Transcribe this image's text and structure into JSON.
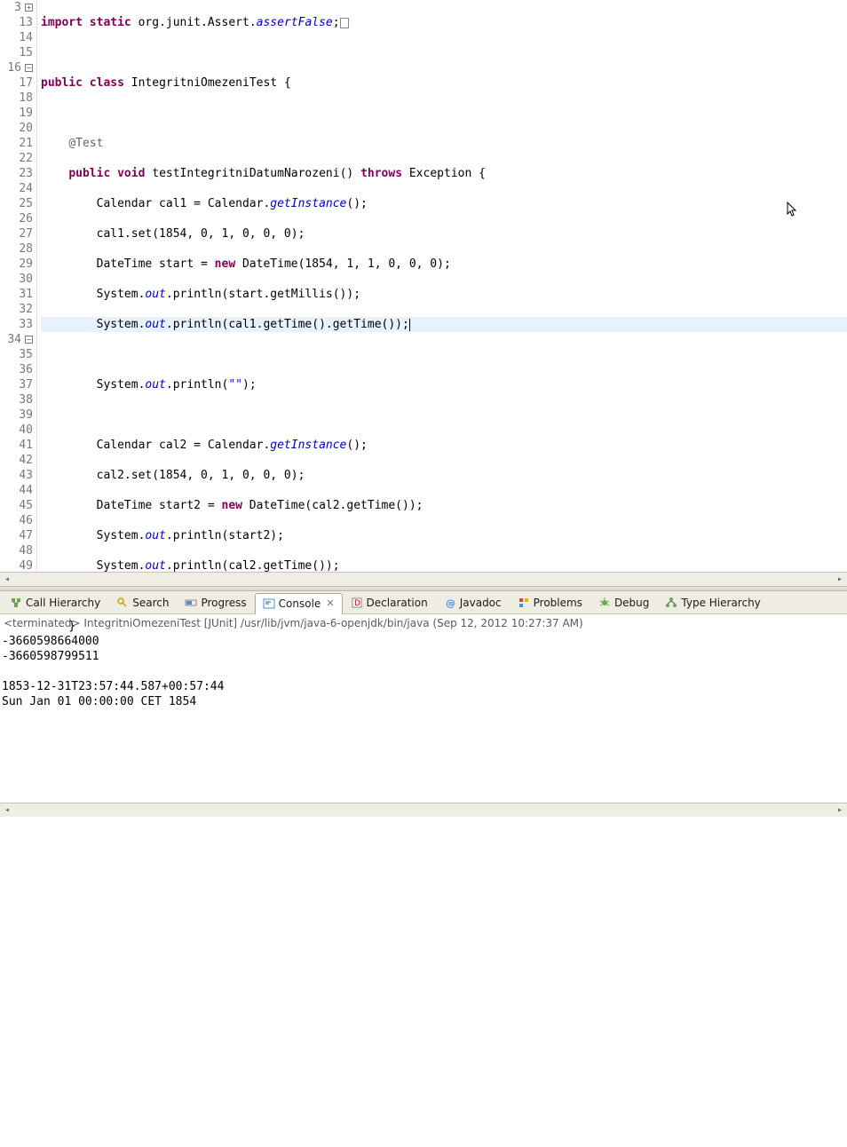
{
  "editor": {
    "lines": [
      {
        "n": 3,
        "marker": "plus"
      },
      {
        "n": 13
      },
      {
        "n": 14
      },
      {
        "n": 15
      },
      {
        "n": 16,
        "marker": "minus"
      },
      {
        "n": 17
      },
      {
        "n": 18
      },
      {
        "n": 19
      },
      {
        "n": 20
      },
      {
        "n": 21
      },
      {
        "n": 22,
        "hl": true
      },
      {
        "n": 23
      },
      {
        "n": 24
      },
      {
        "n": 25
      },
      {
        "n": 26
      },
      {
        "n": 27
      },
      {
        "n": 28
      },
      {
        "n": 29
      },
      {
        "n": 30
      },
      {
        "n": 31
      },
      {
        "n": 32
      },
      {
        "n": 33
      },
      {
        "n": 34,
        "marker": "minus"
      },
      {
        "n": 35
      },
      {
        "n": 36
      },
      {
        "n": 37
      },
      {
        "n": 38
      },
      {
        "n": 39
      },
      {
        "n": 40
      },
      {
        "n": 41
      },
      {
        "n": 42
      },
      {
        "n": 43
      },
      {
        "n": 44
      },
      {
        "n": 45
      },
      {
        "n": 46
      },
      {
        "n": 47
      },
      {
        "n": 48
      },
      {
        "n": 49
      }
    ],
    "code": {
      "l3_a": "import",
      "l3_b": "static",
      "l3_c": " org.junit.Assert.",
      "l3_d": "assertFalse",
      "l3_e": ";",
      "l14_a": "public",
      "l14_b": "class",
      "l14_c": " IntegritniOmezeniTest {",
      "l16": "@Test",
      "l17_a": "public",
      "l17_b": "void",
      "l17_c": " testIntegritniDatumNarozeni() ",
      "l17_d": "throws",
      "l17_e": " Exception {",
      "l18_a": "        Calendar cal1 = Calendar.",
      "l18_b": "getInstance",
      "l18_c": "();",
      "l19": "        cal1.set(1854, 0, 1, 0, 0, 0);",
      "l20_a": "        DateTime start = ",
      "l20_b": "new",
      "l20_c": " DateTime(1854, 1, 1, 0, 0, 0);",
      "l21_a": "        System.",
      "l21_b": "out",
      "l21_c": ".println(start.getMillis());",
      "l22_a": "        System.",
      "l22_b": "out",
      "l22_c": ".println(cal1.getTime().getTime());",
      "l24_a": "        System.",
      "l24_b": "out",
      "l24_c": ".println(",
      "l24_d": "\"\"",
      "l24_e": ");",
      "l26_a": "        Calendar cal2 = Calendar.",
      "l26_b": "getInstance",
      "l26_c": "();",
      "l27": "        cal2.set(1854, 0, 1, 0, 0, 0);",
      "l28_a": "        DateTime start2 = ",
      "l28_b": "new",
      "l28_c": " DateTime(cal2.getTime());",
      "l29_a": "        System.",
      "l29_b": "out",
      "l29_c": ".println(start2);",
      "l30_a": "        System.",
      "l30_b": "out",
      "l30_c": ".println(cal2.getTime());",
      "l32": "    }"
    }
  },
  "tabs": {
    "items": [
      {
        "label": "Call Hierarchy"
      },
      {
        "label": "Search"
      },
      {
        "label": "Progress"
      },
      {
        "label": "Console"
      },
      {
        "label": "Declaration"
      },
      {
        "label": "Javadoc"
      },
      {
        "label": "Problems"
      },
      {
        "label": "Debug"
      },
      {
        "label": "Type Hierarchy"
      }
    ]
  },
  "console": {
    "status": "<terminated> IntegritniOmezeniTest [JUnit] /usr/lib/jvm/java-6-openjdk/bin/java (Sep 12, 2012 10:27:37 AM)",
    "out": "-3660598664000\n-3660598799511\n\n1853-12-31T23:57:44.587+00:57:44\nSun Jan 01 00:00:00 CET 1854"
  }
}
